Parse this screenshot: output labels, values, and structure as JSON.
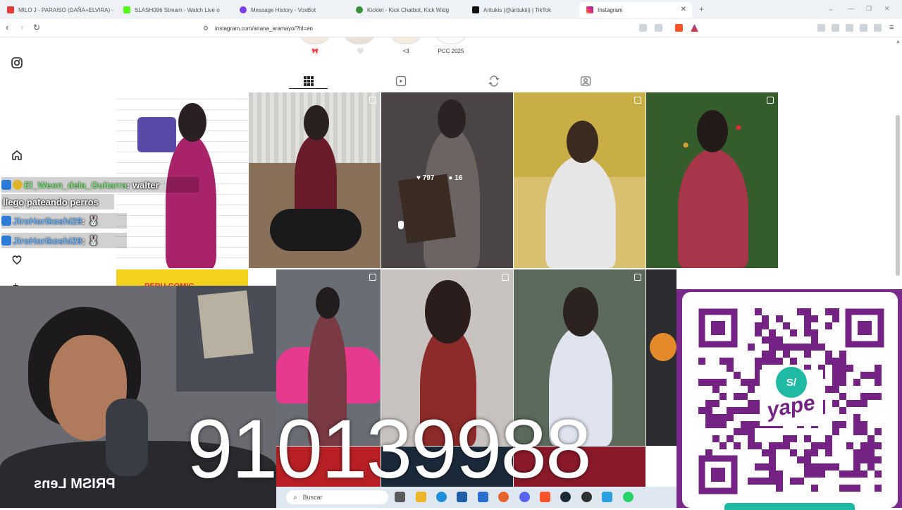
{
  "browser": {
    "tabs": [
      {
        "title": "MILO J - PARAISO (DAÑA+ELVIRA) -",
        "color": "#e53935"
      },
      {
        "title": "SLASH096 Stream - Watch Live o",
        "color": "#53fc18"
      },
      {
        "title": "Message History - VoxBot",
        "color": "#7b3fe4"
      },
      {
        "title": "Kicklet - Kick Chatbot, Kick Widg",
        "color": "#3a8f3a"
      },
      {
        "title": "Aritukis (@aritukiii) | TikTok",
        "color": "#111111"
      },
      {
        "title": "Instagram",
        "color": "#d6249f"
      }
    ],
    "url": "instagram.com/ariana_aramayo/?hl=en"
  },
  "profile": {
    "highlights": [
      "🎀",
      "🤍",
      "<3",
      "PCC 2025"
    ],
    "post_overlay": {
      "likes": "797",
      "comments": "16"
    },
    "partial_post_text": "PERU COMIC"
  },
  "chat": [
    {
      "user": "El_Weon_dela_Guitarra",
      "sep": " :",
      "msg": "walter"
    },
    {
      "user": "",
      "sep": "",
      "msg": "llego pateando perros"
    },
    {
      "user": "JiroHorikoshi29",
      "sep": " :",
      "msg": "🐰"
    },
    {
      "user": "JiroHorikoshi29",
      "sep": " :",
      "msg": "🐰"
    }
  ],
  "stream": {
    "big_number": "910139988",
    "mic_label": "PRISM Lens",
    "qr_brand": "yape",
    "qr_prefix": "S/"
  },
  "taskbar": {
    "search_placeholder": "Buscar"
  },
  "colors": {
    "yape_purple": "#742284",
    "ig_text": "#262626"
  }
}
